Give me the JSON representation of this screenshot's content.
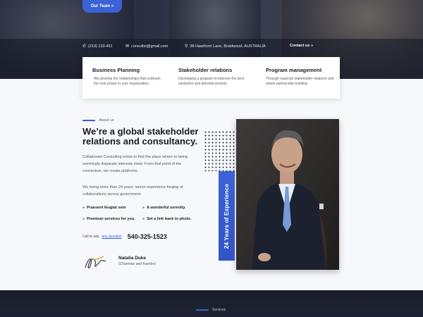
{
  "hero": {
    "team_button": "Our Team »"
  },
  "contact": {
    "phone_icon": "phone-icon",
    "phone": "(210) 123-451",
    "email_icon": "envelope-icon",
    "email": "consultio@gmail.com",
    "location_icon": "map-pin-icon",
    "address": "38 Hawthorn Lane, Braidwood, AUSTRALIA",
    "contact_link": "Contact us »"
  },
  "features": [
    {
      "title": "Business Planning",
      "text": "We develop the relationships that underpin the next phase in your organisation."
    },
    {
      "title": "Stakeholder relations",
      "text": "Developing a program to improve the best sanitation and alleviate poverty."
    },
    {
      "title": "Program management",
      "text": "Through nuanced stakeholder relations and astute partnership building."
    }
  ],
  "about": {
    "tag": "About us",
    "title": "We’re a global stakeholder relations and consultancy.",
    "para1": "Collaborate Consulting exists to find the place where to being seemingly disparate interests meet. From that point of the connection, we create platforms.",
    "para2": "We being more than 24 years’ senior experience forging of collaborations across government.",
    "checks": [
      "Praesent feugiat sem",
      "A wonderful serenity.",
      "Premium services for you.",
      "Set a link back to photo."
    ],
    "call_label": "Call to ask",
    "call_link": "any question",
    "phone": "540-325-1523",
    "person_name": "Natalia Duke",
    "person_role": "(Chairman and founder)"
  },
  "experience_banner": "24 Years of Experience",
  "services": {
    "tag": "Services"
  },
  "colors": {
    "accent": "#3b62d6",
    "dark": "#1d2231"
  }
}
